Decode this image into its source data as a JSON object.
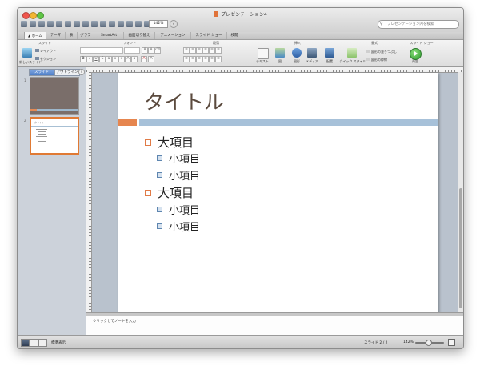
{
  "window": {
    "title": "プレゼンテーション4",
    "zoom": "142%",
    "help": "?",
    "search_placeholder": "プレゼンテーション内を検索"
  },
  "tabs": [
    "ホーム",
    "テーマ",
    "表",
    "グラフ",
    "SmartArt",
    "画面切り替え",
    "アニメーション",
    "スライド ショー",
    "校閲"
  ],
  "ribbon": {
    "groups": [
      "スライド",
      "フォント",
      "段落",
      "挿入",
      "書式",
      "スライド ショー"
    ],
    "slide_group": {
      "new_slide": "新しいスライド",
      "layout": "レイアウト",
      "section": "セクション"
    },
    "insert_group": [
      "テキスト",
      "図",
      "図形",
      "メディア",
      "配置"
    ],
    "format_group": {
      "quick_styles": "クイック スタイル",
      "shape_fill": "図形の塗りつぶし",
      "shape_outline": "図形の枠線"
    },
    "show_group": {
      "play": "再生"
    }
  },
  "left_pane": {
    "tabs": [
      "スライド",
      "アウトライン"
    ],
    "thumbnails": [
      {
        "number": "1"
      },
      {
        "number": "2",
        "title": "タイトル"
      }
    ]
  },
  "slide": {
    "title": "タイトル",
    "bullets": [
      {
        "text": "大項目",
        "level": 1
      },
      {
        "text": "小項目",
        "level": 2
      },
      {
        "text": "小項目",
        "level": 2
      },
      {
        "text": "大項目",
        "level": 1
      },
      {
        "text": "小項目",
        "level": 2
      },
      {
        "text": "小項目",
        "level": 2
      }
    ]
  },
  "notes": {
    "placeholder": "クリックしてノートを入力"
  },
  "status": {
    "view_label": "標準表示",
    "slide_position": "スライド 2 / 2",
    "zoom": "142%"
  },
  "colors": {
    "accent_orange": "#e6864f",
    "title_bar_blue": "#a7c1d9",
    "title_text": "#5b4a3e",
    "selection_orange": "#e07a34"
  }
}
